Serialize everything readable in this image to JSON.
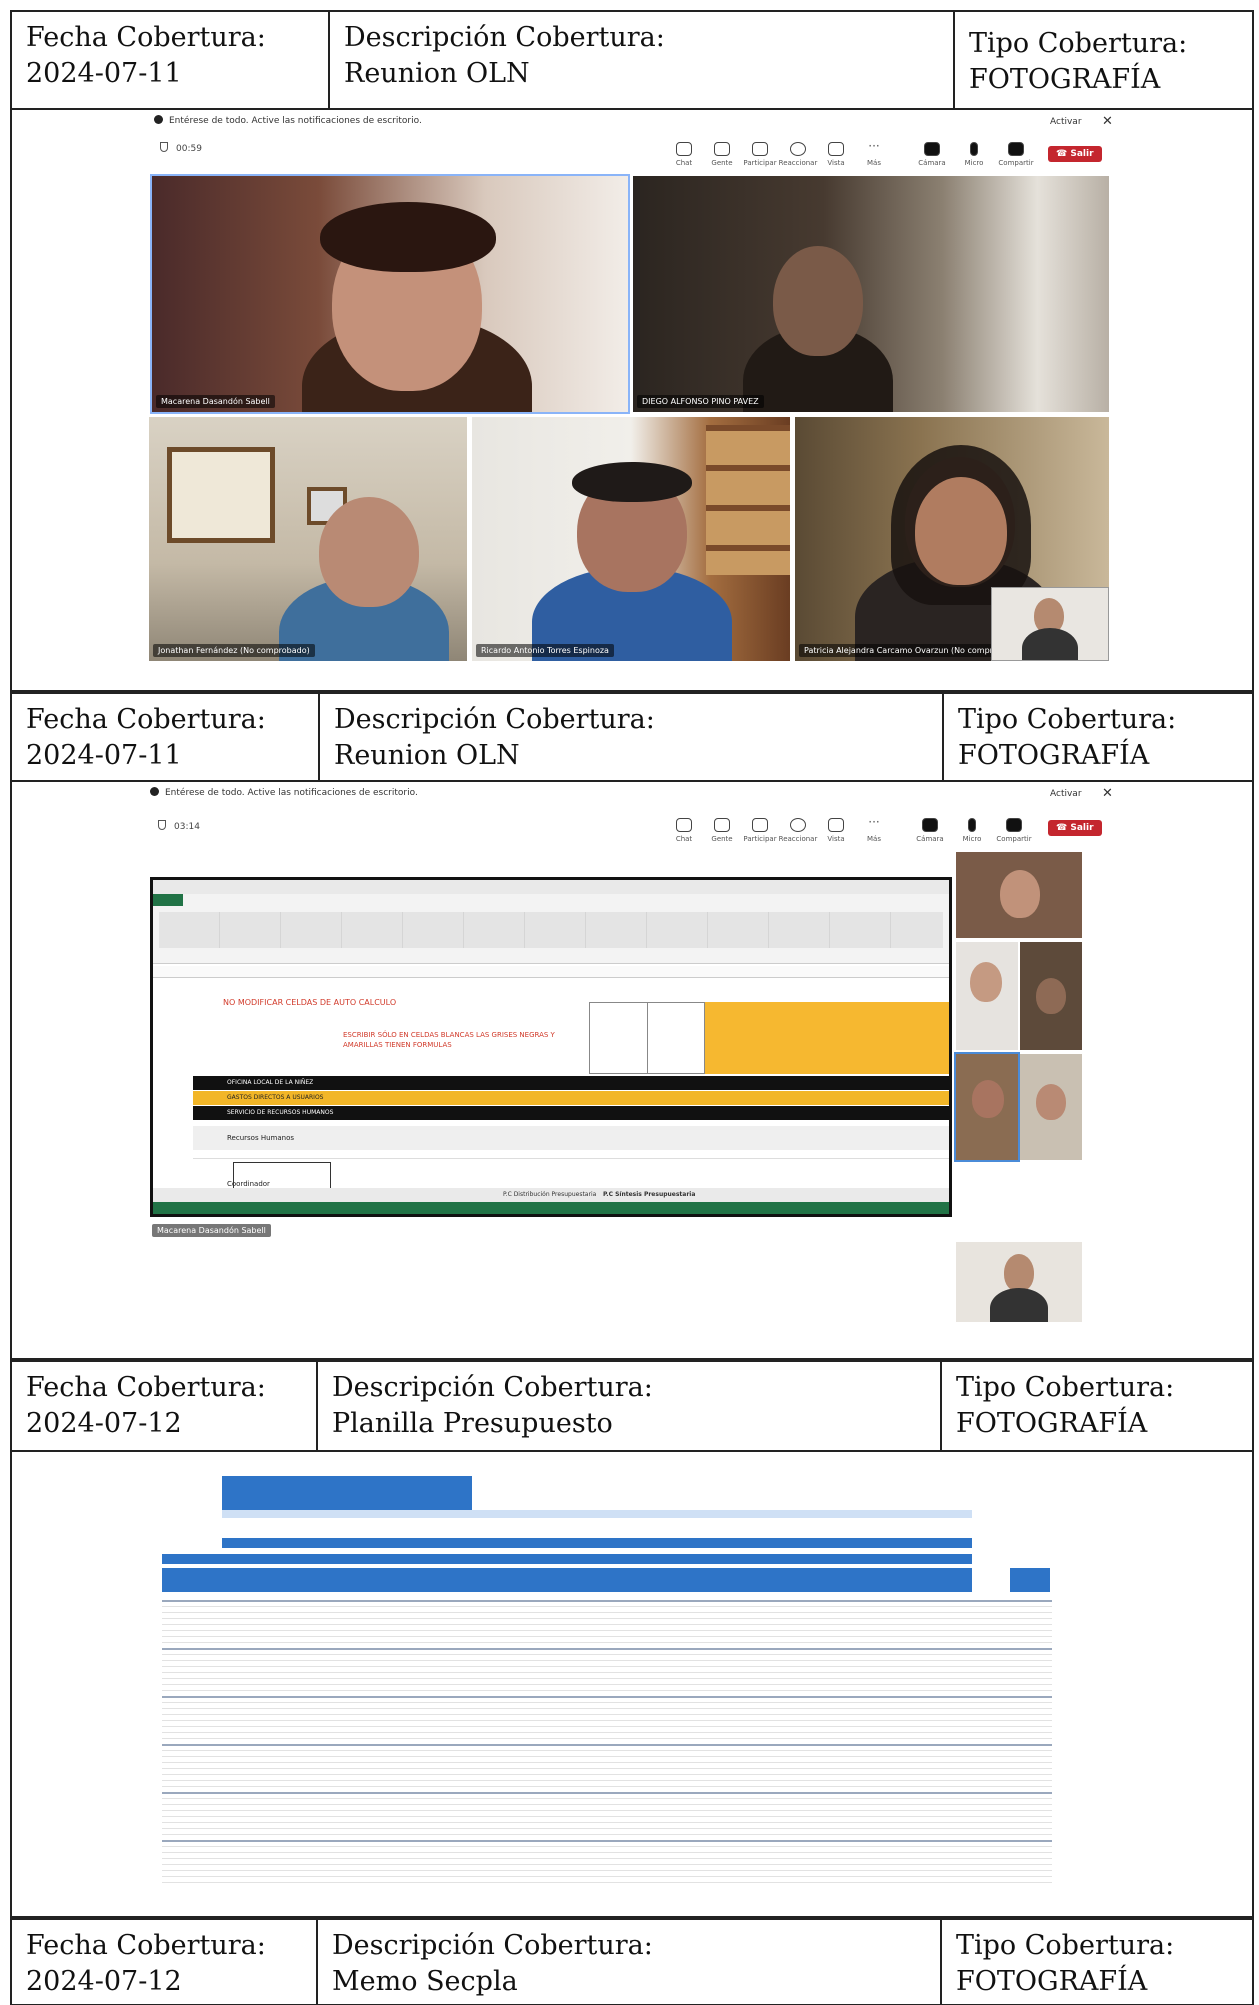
{
  "labels": {
    "fecha": "Fecha Cobertura:",
    "descripcion": "Descripción Cobertura:",
    "tipo": "Tipo Cobertura:"
  },
  "rows": [
    {
      "fecha": "2024-07-11",
      "descripcion": "Reunion OLN",
      "tipo": "FOTOGRAFÍA"
    },
    {
      "fecha": "2024-07-11",
      "descripcion": "Reunion OLN",
      "tipo": "FOTOGRAFÍA"
    },
    {
      "fecha": "2024-07-12",
      "descripcion": "Planilla Presupuesto",
      "tipo": "FOTOGRAFÍA"
    },
    {
      "fecha": "2024-07-12",
      "descripcion": "Memo Secpla",
      "tipo": "FOTOGRAFÍA"
    }
  ],
  "meeting": {
    "notice": "Entérese de todo. Active las notificaciones de escritorio.",
    "activar": "Activar",
    "timer_1": "00:59",
    "timer_2": "03:14",
    "toolbar": [
      "Chat",
      "Gente",
      "Participar",
      "Reaccionar",
      "Vista",
      "Más",
      "Cámara",
      "Micro",
      "Compartir"
    ],
    "exit": "Salir",
    "participants": [
      "Macarena Dasandón Sabell",
      "DIEGO ALFONSO PINO PAVEZ",
      "Jonathan Fernández (No comprobado)",
      "Ricardo Antonio Torres Espinoza",
      "Patricia Alejandra Carcamo Ovarzun (No comprob"
    ],
    "share_label": "Macarena Dasandón Sabell"
  },
  "excel": {
    "notice_red": "NO MODIFICAR CELDAS DE AUTO CALCULO",
    "instr_red": "ESCRIBIR SÓLO EN CELDAS BLANCAS LAS GRISES NEGRAS Y AMARILLAS TIENEN FORMULAS",
    "row_oficina": "OFICINA LOCAL DE LA NIÑEZ",
    "row_gastos": "GASTOS DIRECTOS A USUARIOS",
    "row_servicio": "SERVICIO DE RECURSOS HUMANOS",
    "row_rrhh": "Recursos Humanos",
    "row_coord": "Coordinador",
    "tab_1": "P.C Distribución Presupuestaria",
    "tab_2": "P.C Síntesis Presupuestaria"
  }
}
